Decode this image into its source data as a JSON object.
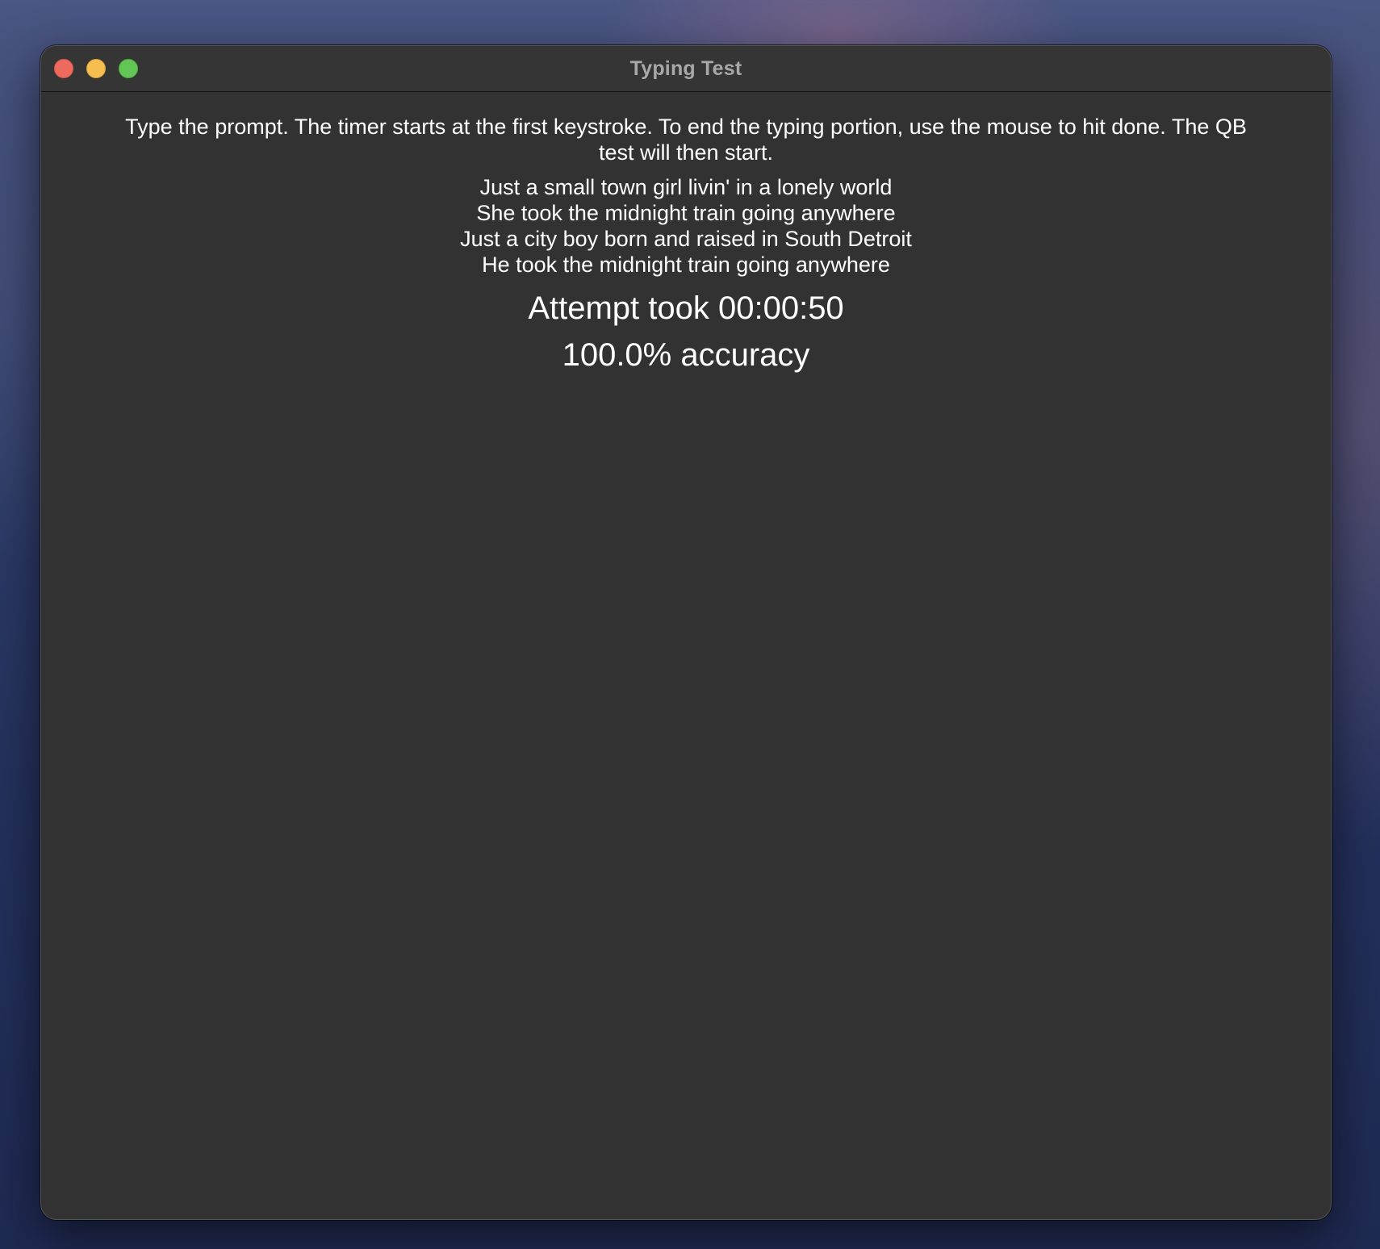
{
  "window": {
    "title": "Typing Test"
  },
  "instructions": "Type the prompt. The timer starts at the first keystroke. To end the typing portion, use the mouse to hit done. The QB test will then start.",
  "prompt_lines": [
    "Just a small town girl livin' in a lonely world",
    "She took the midnight train going anywhere",
    "Just a city boy born and raised in South Detroit",
    "He took the midnight train going anywhere"
  ],
  "results": {
    "attempt_time": "Attempt took 00:00:50",
    "accuracy": "100.0% accuracy"
  },
  "colors": {
    "window_bg": "#323232",
    "text": "#ffffff",
    "title_text": "#a8a8a8",
    "close": "#ee6a5f",
    "minimize": "#f5be4f",
    "zoom": "#62c655"
  }
}
